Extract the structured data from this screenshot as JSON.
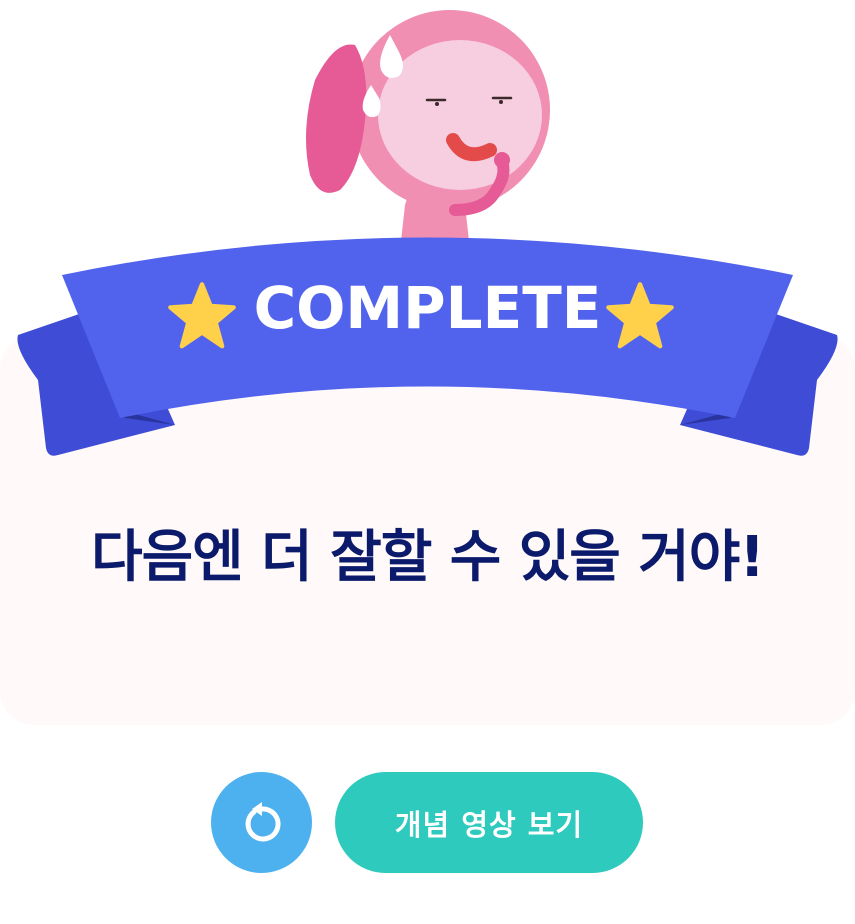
{
  "banner": {
    "title": "COMPLETE",
    "ribbon_color": "#5163ec",
    "ribbon_fold_color": "#3e4cd6",
    "star_color": "#ffd049"
  },
  "message": {
    "text": "다음엔 더 잘할 수 있을 거야!"
  },
  "actions": {
    "retry_icon": "retry-icon",
    "video_label": "개념 영상 보기"
  },
  "colors": {
    "text_dark": "#0b1a6b",
    "retry_bg": "#4cb1ee",
    "video_bg": "#2ecabd",
    "card_bg": "#fffaf9",
    "mascot_pink": "#f08fb2"
  }
}
